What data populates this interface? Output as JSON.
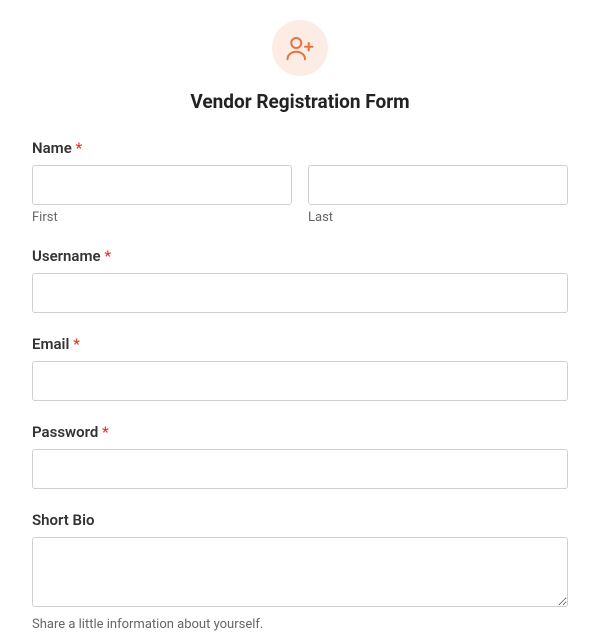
{
  "title": "Vendor Registration Form",
  "required_mark": "*",
  "name": {
    "label": "Name",
    "first_sub": "First",
    "last_sub": "Last"
  },
  "username": {
    "label": "Username"
  },
  "email": {
    "label": "Email"
  },
  "password": {
    "label": "Password"
  },
  "bio": {
    "label": "Short Bio",
    "helper": "Share a little information about yourself."
  }
}
